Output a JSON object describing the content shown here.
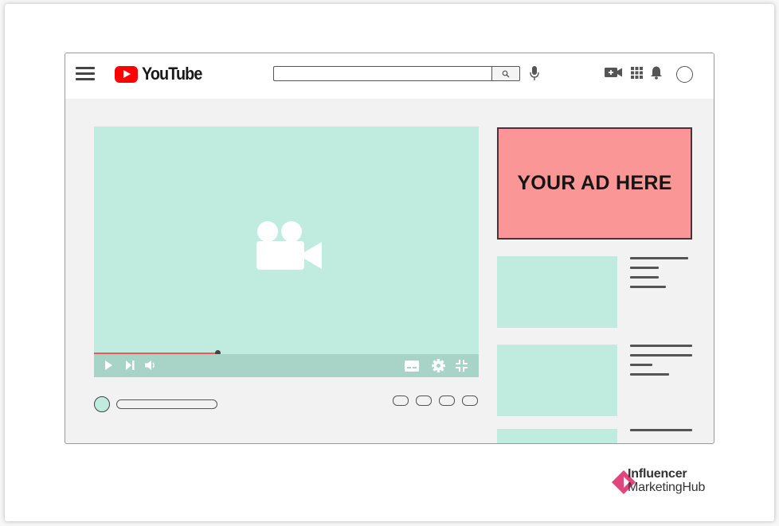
{
  "window": {
    "app_name": "YouTube"
  },
  "topbar": {
    "menu_icon": "hamburger-menu-icon",
    "logo_text": "YouTube",
    "search": {
      "value": "",
      "placeholder": "",
      "button_icon": "search-icon"
    },
    "mic_icon": "microphone-icon",
    "create_icon": "video-camera-plus-icon",
    "apps_icon": "apps-grid-icon",
    "notifications_icon": "bell-icon",
    "account_icon": "avatar-circle"
  },
  "player": {
    "placeholder_icon": "movie-camera-icon",
    "progress": 0.32,
    "controls": [
      "play-icon",
      "next-icon",
      "volume-icon",
      "subtitles-icon",
      "settings-gear-icon",
      "exit-fullscreen-icon"
    ]
  },
  "ad": {
    "text": "YOUR AD HERE"
  },
  "colors": {
    "mint": "#c0ebdf",
    "controls_bg": "#a8d4c7",
    "ad_bg": "#fa9696",
    "youtube_red": "#ff0000",
    "progress": "#e35b5b",
    "brand_accent": "#e0457b"
  },
  "branding": {
    "line1": "Influencer",
    "line2": "MarketingHub"
  }
}
